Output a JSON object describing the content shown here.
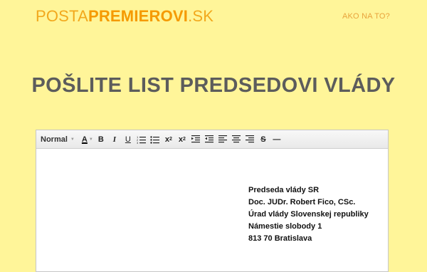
{
  "header": {
    "logo_prefix": "POSTA",
    "logo_strong": "PREMIEROVI",
    "logo_suffix": ".SK",
    "help_link": "AKO NA TO?"
  },
  "main": {
    "title": "POŠLITE LIST PREDSEDOVI VLÁDY"
  },
  "editor": {
    "toolbar": {
      "format_value": "Normal",
      "text_color_label": "A",
      "bold_label": "B",
      "italic_label": "I",
      "underline_label": "U",
      "subscript_label": "x",
      "subscript_mark": "2",
      "superscript_label": "x",
      "superscript_mark": "2",
      "strike_label": "S",
      "hr_label": "—"
    },
    "address_lines": [
      "Predseda vlády SR",
      "Doc. JUDr. Robert Fico, CSc.",
      "Úrad vlády Slovenskej republiky",
      "Námestie slobody 1",
      "813 70 Bratislava"
    ]
  },
  "colors": {
    "background": "#fff599",
    "logo": "#f2a81d",
    "title": "#5c5c5c"
  }
}
